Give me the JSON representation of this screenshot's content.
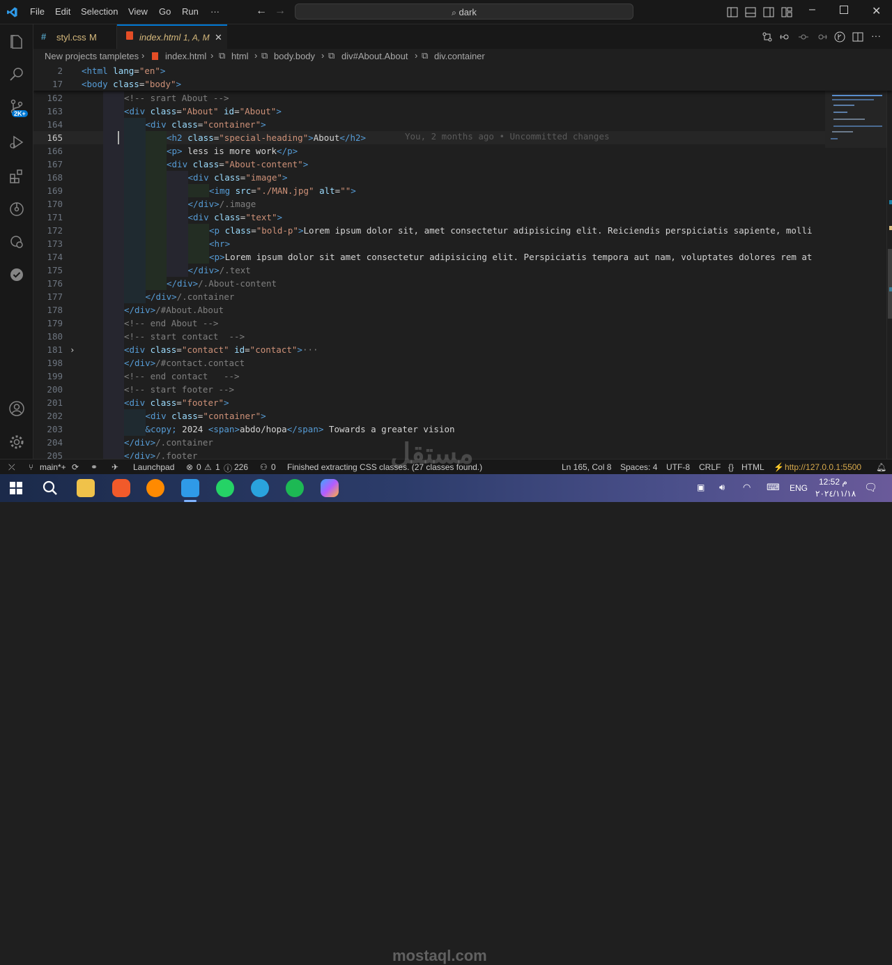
{
  "menu": [
    "File",
    "Edit",
    "Selection",
    "View",
    "Go",
    "Run",
    "···"
  ],
  "search": {
    "text": "dark"
  },
  "tabs": [
    {
      "name": "styl.css",
      "badge": "M"
    },
    {
      "name": "index.html",
      "badge": "1, A, M"
    }
  ],
  "breadcrumb": [
    "New projects tampletes",
    "index.html",
    "html",
    "body.body",
    "div#About.About",
    "div.container"
  ],
  "sticky": [
    {
      "num": "2",
      "html": "<span class='tg'>&lt;html</span> <span class='at'>lang</span><span class='tx'>=</span><span class='st'>\"en\"</span><span class='tg'>&gt;</span>"
    },
    {
      "num": "17",
      "html": "<span class='tg'>&lt;body</span> <span class='at'>class</span><span class='tx'>=</span><span class='st'>\"body\"</span><span class='tg'>&gt;</span>"
    }
  ],
  "lines": [
    {
      "num": "162",
      "indent": 2,
      "html": "<span class='gr'>&lt;!-- srart About --&gt;</span>"
    },
    {
      "num": "163",
      "indent": 2,
      "html": "<span class='tg'>&lt;div</span> <span class='at'>class</span><span class='tx'>=</span><span class='st'>\"About\"</span> <span class='at'>id</span><span class='tx'>=</span><span class='st'>\"About\"</span><span class='tg'>&gt;</span>"
    },
    {
      "num": "164",
      "indent": 3,
      "html": "<span class='tg'>&lt;div</span> <span class='at'>class</span><span class='tx'>=</span><span class='st'>\"container\"</span><span class='tg'>&gt;</span>"
    },
    {
      "num": "165",
      "indent": 4,
      "html": "<span class='tg'>&lt;h2</span> <span class='at'>class</span><span class='tx'>=</span><span class='st'>\"special-heading\"</span><span class='tg'>&gt;</span><span class='tx'>About</span><span class='tg'>&lt;/h2&gt;</span>",
      "current": true
    },
    {
      "num": "166",
      "indent": 4,
      "html": "<span class='tg'>&lt;p&gt;</span><span class='tx'> less is more work</span><span class='tg'>&lt;/p&gt;</span>"
    },
    {
      "num": "167",
      "indent": 4,
      "html": "<span class='tg'>&lt;div</span> <span class='at'>class</span><span class='tx'>=</span><span class='st'>\"About-content\"</span><span class='tg'>&gt;</span>"
    },
    {
      "num": "168",
      "indent": 5,
      "html": "<span class='tg'>&lt;div</span> <span class='at'>class</span><span class='tx'>=</span><span class='st'>\"image\"</span><span class='tg'>&gt;</span>"
    },
    {
      "num": "169",
      "indent": 6,
      "html": "<span class='tg'>&lt;img</span> <span class='at'>src</span><span class='tx'>=</span><span class='st'>\"./MAN.jpg\"</span> <span class='at'>alt</span><span class='tx'>=</span><span class='st'>\"\"</span><span class='tg'>&gt;</span>"
    },
    {
      "num": "170",
      "indent": 5,
      "html": "<span class='tg'>&lt;/div&gt;</span><span class='gr'>/.image</span>"
    },
    {
      "num": "171",
      "indent": 5,
      "html": "<span class='tg'>&lt;div</span> <span class='at'>class</span><span class='tx'>=</span><span class='st'>\"text\"</span><span class='tg'>&gt;</span>"
    },
    {
      "num": "172",
      "indent": 6,
      "html": "<span class='tg'>&lt;p</span> <span class='at'>class</span><span class='tx'>=</span><span class='st'>\"bold-p\"</span><span class='tg'>&gt;</span><span class='tx'>Lorem ipsum dolor sit, amet consectetur adipisicing elit. Reiciendis perspiciatis sapiente, molli</span>"
    },
    {
      "num": "173",
      "indent": 6,
      "html": "<span class='tg'>&lt;hr&gt;</span>"
    },
    {
      "num": "174",
      "indent": 6,
      "html": "<span class='tg'>&lt;p&gt;</span><span class='tx'>Lorem ipsum dolor sit amet consectetur adipisicing elit. Perspiciatis tempora aut nam, voluptates dolores rem at</span>"
    },
    {
      "num": "175",
      "indent": 5,
      "html": "<span class='tg'>&lt;/div&gt;</span><span class='gr'>/.text</span>"
    },
    {
      "num": "176",
      "indent": 4,
      "html": "<span class='tg'>&lt;/div&gt;</span><span class='gr'>/.About-content</span>"
    },
    {
      "num": "177",
      "indent": 3,
      "html": "<span class='tg'>&lt;/div&gt;</span><span class='gr'>/.container</span>"
    },
    {
      "num": "178",
      "indent": 2,
      "html": "<span class='tg'>&lt;/div&gt;</span><span class='gr'>/#About.About</span>"
    },
    {
      "num": "179",
      "indent": 2,
      "html": "<span class='gr'>&lt;!-- end About --&gt;</span>"
    },
    {
      "num": "180",
      "indent": 2,
      "html": "<span class='gr'>&lt;!-- start contact  --&gt;</span>"
    },
    {
      "num": "181",
      "indent": 2,
      "html": "<span class='tg'>&lt;div</span> <span class='at'>class</span><span class='tx'>=</span><span class='st'>\"contact\"</span> <span class='at'>id</span><span class='tx'>=</span><span class='st'>\"contact\"</span><span class='tg'>&gt;</span><span class='gr'>···</span>",
      "fold": true
    },
    {
      "num": "198",
      "indent": 2,
      "html": "<span class='tg'>&lt;/div&gt;</span><span class='gr'>/#contact.contact</span>"
    },
    {
      "num": "199",
      "indent": 2,
      "html": "<span class='gr'>&lt;!-- end contact   --&gt;</span>"
    },
    {
      "num": "200",
      "indent": 2,
      "html": "<span class='gr'>&lt;!-- start footer --&gt;</span>"
    },
    {
      "num": "201",
      "indent": 2,
      "html": "<span class='tg'>&lt;div</span> <span class='at'>class</span><span class='tx'>=</span><span class='st'>\"footer\"</span><span class='tg'>&gt;</span>"
    },
    {
      "num": "202",
      "indent": 3,
      "html": "<span class='tg'>&lt;div</span> <span class='at'>class</span><span class='tx'>=</span><span class='st'>\"container\"</span><span class='tg'>&gt;</span>"
    },
    {
      "num": "203",
      "indent": 3,
      "html": "<span class='en'>&amp;copy;</span><span class='tx'> 2024 </span><span class='tg'>&lt;span&gt;</span><span class='tx'>abdo/hopa</span><span class='tg'>&lt;/span&gt;</span><span class='tx'> Towards a greater vision</span>"
    },
    {
      "num": "204",
      "indent": 2,
      "html": "<span class='tg'>&lt;/div&gt;</span><span class='gr'>/.container</span>"
    },
    {
      "num": "205",
      "indent": 2,
      "html": "<span class='tg'>&lt;/div&gt;</span><span class='gr'>/.footer</span>"
    }
  ],
  "blame": "You, 2 months ago • Uncommitted changes",
  "status": {
    "branch": "main*+",
    "launchpad": "Launchpad",
    "errors": "0",
    "warnings": "1",
    "info": "226",
    "ports": "0",
    "message": "Finished extracting CSS classes. (27 classes found.)",
    "position": "Ln 165, Col 8",
    "spaces": "Spaces: 4",
    "encoding": "UTF-8",
    "eol": "CRLF",
    "language": "HTML",
    "live": "http://127.0.0.1:5500"
  },
  "taskbar": {
    "lang": "ENG",
    "time": "12:52 م",
    "date": "٢٠٢٤/١١/١٨"
  },
  "watermark": {
    "ar": "مستقل",
    "en": "mostaql.com"
  },
  "colors": {
    "accent": "#0078d4",
    "bg": "#1f1f1f",
    "chrome": "#181818"
  }
}
